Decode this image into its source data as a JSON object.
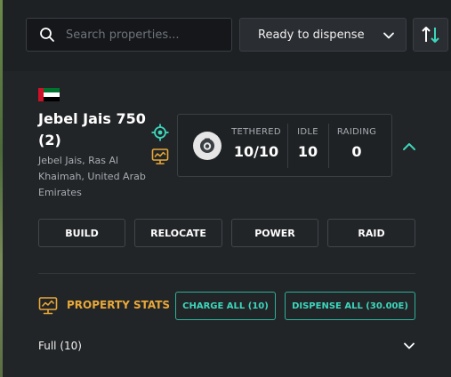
{
  "search": {
    "placeholder": "Search properties..."
  },
  "filter": {
    "selected": "Ready to dispense"
  },
  "property": {
    "name": "Jebel Jais 750 (2)",
    "location": "Jebel Jais, Ras Al Khaimah, United Arab Emirates",
    "flag_icon": "uae-flag-icon"
  },
  "units": {
    "tethered": {
      "label": "TETHERED",
      "value": "10/10"
    },
    "idle": {
      "label": "IDLE",
      "value": "10"
    },
    "raiding": {
      "label": "RAIDING",
      "value": "0"
    }
  },
  "actions": {
    "build": "BUILD",
    "relocate": "RELOCATE",
    "power": "POWER",
    "raid": "RAID"
  },
  "stats": {
    "title": "PROPERTY STATS",
    "charge_all": "CHARGE ALL (10)",
    "dispense_all": "DISPENSE ALL (30.00E)",
    "full": "Full (10)"
  },
  "colors": {
    "background": "#1b1d1f",
    "panel": "#222528",
    "accent_teal": "#3dd6bc",
    "accent_amber": "#e8a838",
    "flag_red": "#ce1126",
    "flag_green": "#00732f"
  }
}
